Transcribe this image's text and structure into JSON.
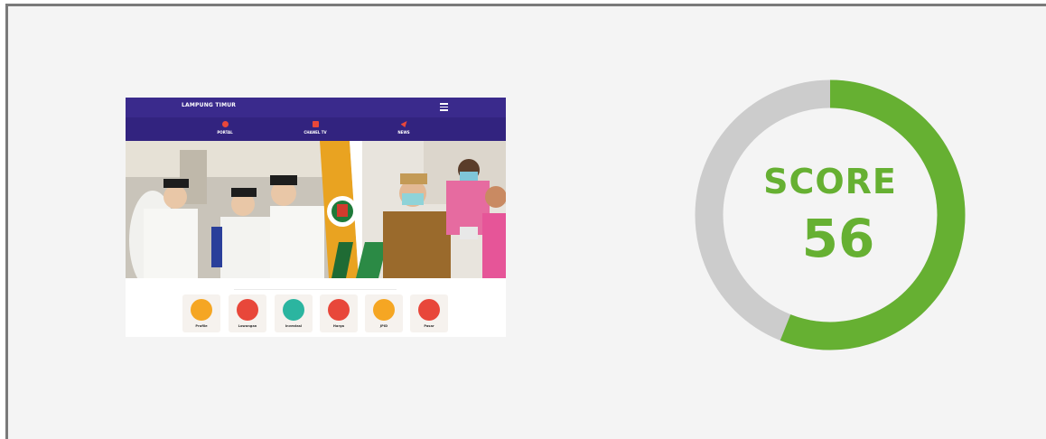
{
  "preview": {
    "site_title": "LAMPUNG TIMUR",
    "nav": [
      {
        "label": "PORTAL",
        "icon": "globe-icon"
      },
      {
        "label": "CHANEL TV",
        "icon": "tv-icon"
      },
      {
        "label": "NEWS",
        "icon": "send-icon"
      }
    ],
    "quick_links": [
      {
        "label": "Profile",
        "icon": "map-pin-icon",
        "color": "#f5a623"
      },
      {
        "label": "Lowongan",
        "icon": "handshake-icon",
        "color": "#e8473a"
      },
      {
        "label": "Investasi",
        "icon": "laptop-icon",
        "color": "#2bb5a0"
      },
      {
        "label": "Harga",
        "icon": "coins-icon",
        "color": "#e8473a"
      },
      {
        "label": "JPID",
        "icon": "phone-icon",
        "color": "#f5a623"
      },
      {
        "label": "Pasar",
        "icon": "basket-icon",
        "color": "#e8473a"
      }
    ]
  },
  "score": {
    "label": "SCORE",
    "value": "56",
    "fraction": 0.56,
    "color": "#66b032",
    "track_color": "#cccccc"
  }
}
